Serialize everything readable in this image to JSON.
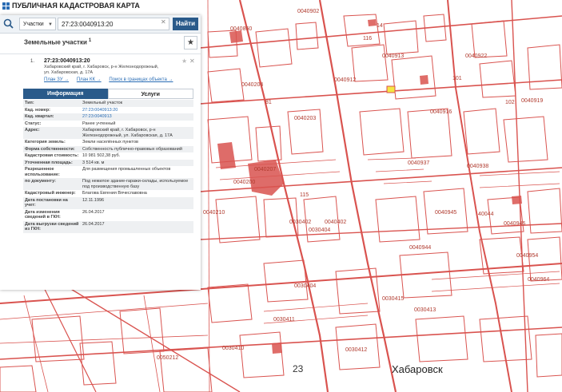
{
  "app": {
    "title": "ПУБЛИЧНАЯ КАДАСТРОВАЯ КАРТА"
  },
  "search": {
    "type_label": "Участки",
    "value": "27:23:0040913:20",
    "button_label": "Найти"
  },
  "results": {
    "title": "Земельные участки",
    "count": "1"
  },
  "result": {
    "number": "1.",
    "cad_number": "27:23:0040913:20",
    "address": "Хабаровский край, г. Хабаровск, р-н Железнодорожный, ул. Хабаровская, д. 17А",
    "links": [
      "План ЗУ →",
      "План КК →",
      "Поиск в границах объекта →"
    ]
  },
  "tabs": [
    "Информация",
    "Услуги"
  ],
  "info": [
    {
      "key": "Тип:",
      "value": "Земельный участок"
    },
    {
      "key": "Кад. номер:",
      "value": "27:23:0040913:20",
      "link": true
    },
    {
      "key": "Кад. квартал:",
      "value": "27:23:0040913",
      "link": true
    },
    {
      "key": "Статус:",
      "value": "Ранее учтенный"
    },
    {
      "key": "Адрес:",
      "value": "Хабаровский край, г. Хабаровск, р-н Железнодорожный, ул. Хабаровская, д. 17А"
    },
    {
      "key": "Категория земель:",
      "value": "Земли населённых пунктов"
    },
    {
      "key": "Форма собственности:",
      "value": "Собственность публично-правовых образований"
    },
    {
      "key": "Кадастровая стоимость:",
      "value": "10 981 502,38 руб."
    },
    {
      "key": "Уточненная площадь:",
      "value": "3 514 кв. м"
    },
    {
      "key": "Разрешенное использование:",
      "value": "Для размещения промышленных объектов"
    },
    {
      "key": "по документу:",
      "value": "Под нежилое здание-гаражи-склады, используемое под производственную базу"
    },
    {
      "key": "Кадастровый инженер:",
      "value": "Благова Евгения Вячеславовна"
    },
    {
      "key": "Дата постановки на учет:",
      "value": "12.11.1996"
    },
    {
      "key": "Дата изменения сведений в ГКН:",
      "value": "26.04.2017"
    },
    {
      "key": "Дата выгрузки сведений из ГКН:",
      "value": "26.04.2017"
    }
  ],
  "map": {
    "city_label": "Хабаровск",
    "block_label": "23",
    "colors": {
      "parcel": "#d9534f",
      "highlight": "#f5e642",
      "panel_accent": "#2a5a8a"
    },
    "labels": [
      "0040902",
      "0040860",
      "0040913",
      "0040922",
      "0040912",
      "0040919",
      "0040916",
      "0040937",
      "0040938",
      "0040204",
      "0040203",
      "0040207",
      "0030402",
      "0040200",
      "0040402",
      "0030404",
      "0040944",
      "0040945",
      "0040946",
      "0040954",
      "0040964",
      "0030413",
      "0030410",
      "0030412",
      "0030411",
      "0030415",
      "0050212",
      "0040210",
      "0030404",
      "40044",
      "14",
      "116",
      "115",
      "102",
      "101",
      "81"
    ]
  }
}
